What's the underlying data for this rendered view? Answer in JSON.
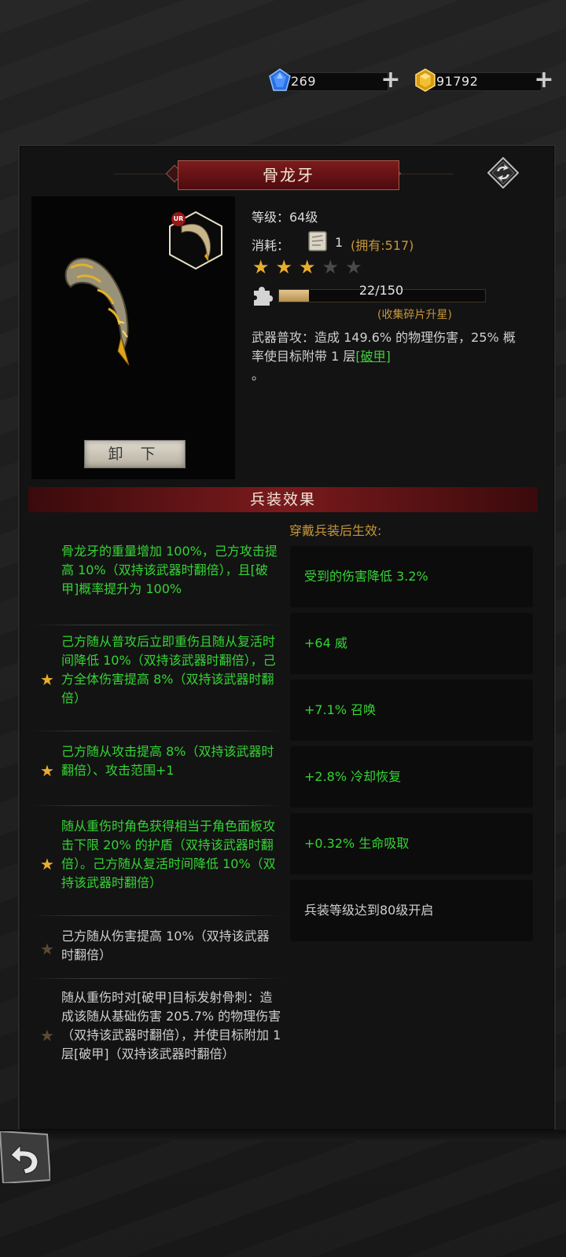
{
  "currency": {
    "gem_value": "269",
    "gold_value": "91792"
  },
  "item": {
    "title": "骨龙牙",
    "rarity_badge": "UR",
    "unequip_label": "卸 下",
    "level_line": "等级：64级",
    "cost_label": "消耗：",
    "cost_amount": "1",
    "cost_owned": "(拥有:517)",
    "stars_filled": 3,
    "stars_total": 5,
    "fragments_text": "22/150",
    "fragments_current": 22,
    "fragments_required": 150,
    "fragments_hint": "(收集碎片升星)",
    "desc_part1": "武器普攻：造成 149.6% 的物理伤害，25% 概率使目标附带 1 层",
    "desc_link": "[破甲]",
    "desc_part2": "。"
  },
  "effects": {
    "header": "兵装效果",
    "wear_title": "穿戴兵装后生效:",
    "list": [
      {
        "text": "骨龙牙的重量增加 100%，己方攻击提高 10%（双持该武器时翻倍），且[破甲]概率提升为 100%",
        "active": true,
        "star": "none"
      },
      {
        "text": "己方随从普攻后立即重伤且随从复活时间降低 10%（双持该武器时翻倍），己方全体伤害提高 8%（双持该武器时翻倍）",
        "active": true,
        "star": "gold"
      },
      {
        "text": "己方随从攻击提高 8%（双持该武器时翻倍）、攻击范围+1",
        "active": true,
        "star": "gold"
      },
      {
        "text": "随从重伤时角色获得相当于角色面板攻击下限 20% 的护盾（双持该武器时翻倍）。己方随从复活时间降低 10%（双持该武器时翻倍）",
        "active": true,
        "star": "gold"
      },
      {
        "text": "己方随从伤害提高 10%（双持该武器时翻倍）",
        "active": false,
        "star": "dim"
      },
      {
        "text": "随从重伤时对[破甲]目标发射骨刺：造成该随从基础伤害 205.7% 的物理伤害（双持该武器时翻倍），并使目标附加 1 层[破甲]（双持该武器时翻倍）",
        "active": false,
        "star": "dim"
      }
    ],
    "stats": [
      {
        "text": "受到的伤害降低 3.2%",
        "active": true
      },
      {
        "text": "+64 威",
        "active": true
      },
      {
        "text": "+7.1% 召唤",
        "active": true
      },
      {
        "text": "+2.8% 冷却恢复",
        "active": true
      },
      {
        "text": "+0.32% 生命吸取",
        "active": true
      },
      {
        "text": "兵装等级达到80级开启",
        "active": false
      }
    ]
  },
  "colors": {
    "active_text": "#35d435",
    "inactive_text": "#cfcfcf",
    "accent_gold": "#c7963a",
    "title_red": "#7e1b1d"
  }
}
